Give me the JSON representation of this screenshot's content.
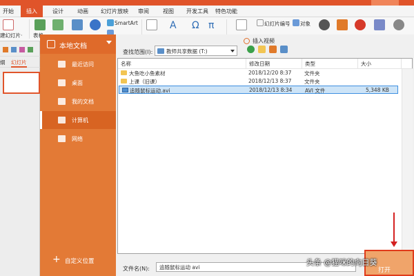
{
  "ribbon": {
    "tabs": [
      "开始",
      "插入",
      "设计",
      "动画",
      "幻灯片放映",
      "审阅",
      "视图",
      "开发工具",
      "特色功能"
    ],
    "active_tab": "插入",
    "labels": {
      "new_slide": "建幻灯片·",
      "table": "表格",
      "smartart": "SmartArt",
      "slide_number": "幻灯片编号",
      "object": "对象"
    },
    "icon_glyphs": {
      "textbox": "A",
      "wordart": "A",
      "symbol": "Ω",
      "equation": "π"
    }
  },
  "slide_panel": {
    "tabs": [
      "纲",
      "幻灯片"
    ],
    "active_tab": "幻灯片"
  },
  "dialog": {
    "title": "插入视频",
    "nav_head": "本地文档",
    "nav_items": [
      {
        "label": "最近访问",
        "icon": "clock-icon"
      },
      {
        "label": "桌面",
        "icon": "desktop-icon"
      },
      {
        "label": "我的文档",
        "icon": "documents-icon"
      },
      {
        "label": "计算机",
        "icon": "computer-icon"
      },
      {
        "label": "网络",
        "icon": "network-icon"
      }
    ],
    "active_nav": "计算机",
    "custom_location": "自定义位置",
    "range_label": "查找范围(I):",
    "range_value": "教师共享数据 (T:)",
    "columns": [
      "名称",
      "修改日期",
      "类型",
      "大小"
    ],
    "files": [
      {
        "name": "大鱼吃小鱼素材",
        "date": "2018/12/20 8:37",
        "type": "文件夹",
        "size": "",
        "kind": "folder"
      },
      {
        "name": "上课（旧课）",
        "date": "2018/12/13 8:37",
        "type": "文件夹",
        "size": "",
        "kind": "folder"
      },
      {
        "name": "追随鼠标运动.avi",
        "date": "2018/12/13 8:34",
        "type": "AVI 文件",
        "size": "5,348 KB",
        "kind": "video",
        "selected": true
      }
    ],
    "filename_label": "文件名(N):",
    "filename_value": "追随鼠标运动 avi",
    "open_button": "打开"
  },
  "watermark": "头条 @猫咪的向日葵",
  "colors": {
    "accent": "#e0542a",
    "nav_bg": "#e37a36",
    "selection": "#cde4f7",
    "annotation": "#d42020"
  }
}
